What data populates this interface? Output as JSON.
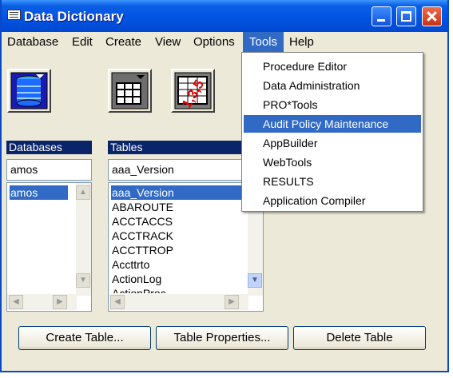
{
  "window": {
    "title": "Data Dictionary"
  },
  "menubar": {
    "items": [
      "Database",
      "Edit",
      "Create",
      "View",
      "Options",
      "Tools",
      "Help"
    ],
    "active": "Tools"
  },
  "databases": {
    "label": "Databases",
    "field_value": "amos",
    "items": [
      "amos"
    ],
    "selected": "amos"
  },
  "tables": {
    "label": "Tables",
    "field_value": "aaa_Version",
    "items": [
      "aaa_Version",
      "ABAROUTE",
      "ACCTACCS",
      "ACCTRACK",
      "ACCTTROP",
      "Accttrto",
      "ActionLog",
      "ActionProc"
    ],
    "selected": "aaa_Version"
  },
  "toolbar": {
    "sequence_badge": "1,3,5"
  },
  "buttons": {
    "create_table": "Create Table...",
    "table_properties": "Table Properties...",
    "delete_table": "Delete Table"
  },
  "tools_menu": {
    "items": [
      "Procedure Editor",
      "Data Administration",
      "PRO*Tools",
      "Audit Policy Maintenance",
      "AppBuilder",
      "WebTools",
      "RESULTS",
      "Application Compiler"
    ],
    "highlighted": "Audit Policy Maintenance"
  },
  "colors": {
    "selection": "#316ac5",
    "titlebar": "#0054e3",
    "label_bg": "#0a246a"
  }
}
